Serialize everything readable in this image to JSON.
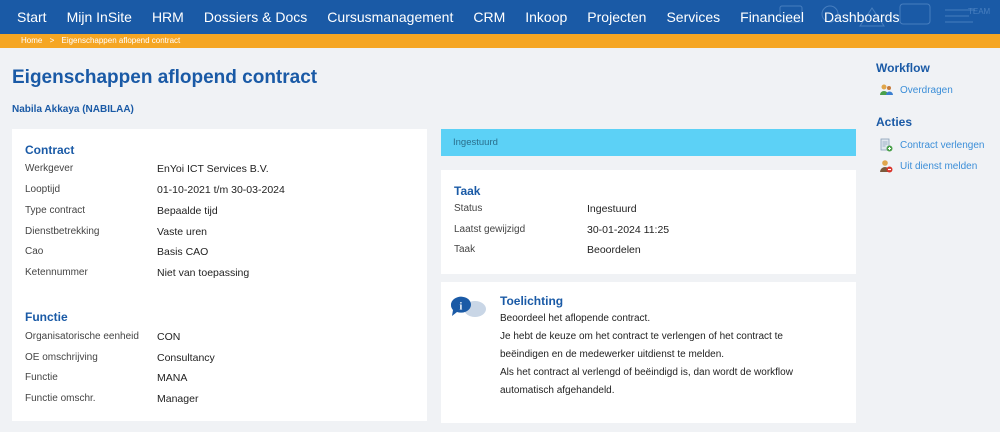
{
  "nav": {
    "items": [
      "Start",
      "Mijn InSite",
      "HRM",
      "Dossiers & Docs",
      "Cursusmanagement",
      "CRM",
      "Inkoop",
      "Projecten",
      "Services",
      "Financieel",
      "Dashboards"
    ]
  },
  "breadcrumb": {
    "home": "Home",
    "sep": ">",
    "current": "Eigenschappen aflopend contract"
  },
  "page": {
    "title": "Eigenschappen aflopend contract",
    "person": "Nabila Akkaya (NABILAA)"
  },
  "contract": {
    "title": "Contract",
    "rows": [
      {
        "label": "Werkgever",
        "value": "EnYoi ICT Services B.V."
      },
      {
        "label": "Looptijd",
        "value": "01-10-2021 t/m 30-03-2024"
      },
      {
        "label": "Type contract",
        "value": "Bepaalde tijd"
      },
      {
        "label": "Dienstbetrekking",
        "value": "Vaste uren"
      },
      {
        "label": "Cao",
        "value": "Basis CAO"
      },
      {
        "label": "Ketennummer",
        "value": "Niet van toepassing"
      }
    ]
  },
  "functie": {
    "title": "Functie",
    "rows": [
      {
        "label": "Organisatorische eenheid",
        "value": "CON"
      },
      {
        "label": "OE omschrijving",
        "value": "Consultancy"
      },
      {
        "label": "Functie",
        "value": "MANA"
      },
      {
        "label": "Functie omschr.",
        "value": "Manager"
      }
    ]
  },
  "status_banner": "Ingestuurd",
  "taak": {
    "title": "Taak",
    "rows": [
      {
        "label": "Status",
        "value": "Ingestuurd"
      },
      {
        "label": "Laatst gewijzigd",
        "value": "30-01-2024 11:25"
      },
      {
        "label": "Taak",
        "value": "Beoordelen"
      }
    ]
  },
  "toelichting": {
    "title": "Toelichting",
    "lines": [
      "Beoordeel het aflopende contract.",
      "Je hebt de keuze om het contract te verlengen of het contract te",
      "beëindigen en de medewerker uitdienst te melden.",
      "Als het contract al verlengd of beëindigd is, dan wordt de workflow",
      "automatisch afgehandeld."
    ]
  },
  "sidebar": {
    "workflow_title": "Workflow",
    "workflow_link": "Overdragen",
    "acties_title": "Acties",
    "acties_links": [
      "Contract verlengen",
      "Uit dienst melden"
    ]
  },
  "colors": {
    "nav": "#1a5aa6",
    "accent": "#f5a623",
    "banner": "#5cd1f6",
    "link": "#3b8ed8"
  }
}
